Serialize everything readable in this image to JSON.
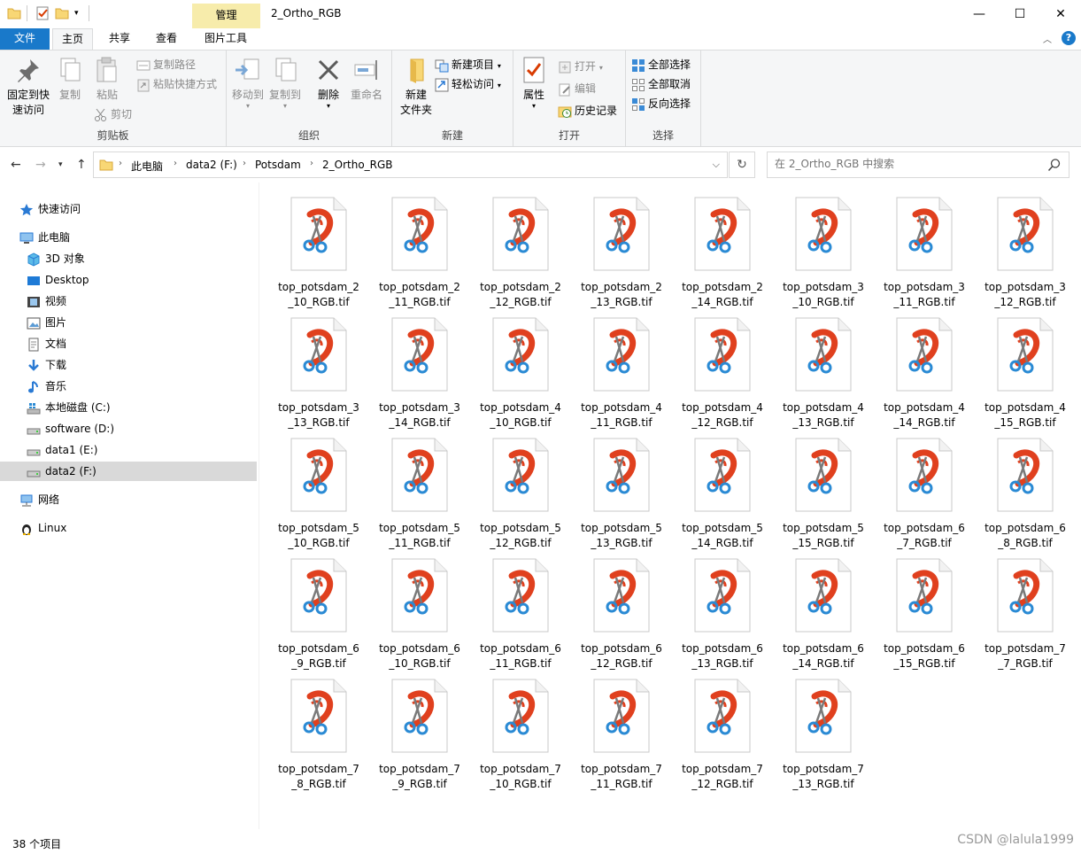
{
  "window": {
    "title": "2_Ortho_RGB",
    "manage_tab": "管理",
    "minimize": "—",
    "maximize": "☐",
    "close": "✕"
  },
  "ribbon_tabs": {
    "file": "文件",
    "home": "主页",
    "share": "共享",
    "view": "查看",
    "picture_tools": "图片工具"
  },
  "ribbon": {
    "clipboard": {
      "label": "剪贴板",
      "pin": "固定到快速访问",
      "pin_line1": "固定到快",
      "pin_line2": "速访问",
      "copy": "复制",
      "paste": "粘贴",
      "copy_path": "复制路径",
      "paste_shortcut": "粘贴快捷方式",
      "cut": "剪切"
    },
    "organize": {
      "label": "组织",
      "move_to": "移动到",
      "copy_to": "复制到",
      "delete": "删除",
      "rename": "重命名"
    },
    "new": {
      "label": "新建",
      "new_folder_line1": "新建",
      "new_folder_line2": "文件夹",
      "new_item": "新建项目",
      "easy_access": "轻松访问"
    },
    "open": {
      "label": "打开",
      "properties": "属性",
      "open": "打开",
      "edit": "编辑",
      "history": "历史记录"
    },
    "select": {
      "label": "选择",
      "select_all": "全部选择",
      "select_none": "全部取消",
      "invert": "反向选择"
    }
  },
  "address": {
    "crumbs": [
      "此电脑",
      "data2 (F:)",
      "Potsdam",
      "2_Ortho_RGB"
    ],
    "search_placeholder": "在 2_Ortho_RGB 中搜索"
  },
  "nav": {
    "quick_access": "快速访问",
    "this_pc": "此电脑",
    "objects3d": "3D 对象",
    "desktop": "Desktop",
    "videos": "视频",
    "pictures": "图片",
    "documents": "文档",
    "downloads": "下载",
    "music": "音乐",
    "drive_c": "本地磁盘 (C:)",
    "drive_d": "software (D:)",
    "drive_e": "data1 (E:)",
    "drive_f": "data2 (F:)",
    "network": "网络",
    "linux": "Linux"
  },
  "files": [
    {
      "line1": "top_potsdam_2",
      "line2": "_10_RGB.tif"
    },
    {
      "line1": "top_potsdam_2",
      "line2": "_11_RGB.tif"
    },
    {
      "line1": "top_potsdam_2",
      "line2": "_12_RGB.tif"
    },
    {
      "line1": "top_potsdam_2",
      "line2": "_13_RGB.tif"
    },
    {
      "line1": "top_potsdam_2",
      "line2": "_14_RGB.tif"
    },
    {
      "line1": "top_potsdam_3",
      "line2": "_10_RGB.tif"
    },
    {
      "line1": "top_potsdam_3",
      "line2": "_11_RGB.tif"
    },
    {
      "line1": "top_potsdam_3",
      "line2": "_12_RGB.tif"
    },
    {
      "line1": "top_potsdam_3",
      "line2": "_13_RGB.tif"
    },
    {
      "line1": "top_potsdam_3",
      "line2": "_14_RGB.tif"
    },
    {
      "line1": "top_potsdam_4",
      "line2": "_10_RGB.tif"
    },
    {
      "line1": "top_potsdam_4",
      "line2": "_11_RGB.tif"
    },
    {
      "line1": "top_potsdam_4",
      "line2": "_12_RGB.tif"
    },
    {
      "line1": "top_potsdam_4",
      "line2": "_13_RGB.tif"
    },
    {
      "line1": "top_potsdam_4",
      "line2": "_14_RGB.tif"
    },
    {
      "line1": "top_potsdam_4",
      "line2": "_15_RGB.tif"
    },
    {
      "line1": "top_potsdam_5",
      "line2": "_10_RGB.tif"
    },
    {
      "line1": "top_potsdam_5",
      "line2": "_11_RGB.tif"
    },
    {
      "line1": "top_potsdam_5",
      "line2": "_12_RGB.tif"
    },
    {
      "line1": "top_potsdam_5",
      "line2": "_13_RGB.tif"
    },
    {
      "line1": "top_potsdam_5",
      "line2": "_14_RGB.tif"
    },
    {
      "line1": "top_potsdam_5",
      "line2": "_15_RGB.tif"
    },
    {
      "line1": "top_potsdam_6",
      "line2": "_7_RGB.tif"
    },
    {
      "line1": "top_potsdam_6",
      "line2": "_8_RGB.tif"
    },
    {
      "line1": "top_potsdam_6",
      "line2": "_9_RGB.tif"
    },
    {
      "line1": "top_potsdam_6",
      "line2": "_10_RGB.tif"
    },
    {
      "line1": "top_potsdam_6",
      "line2": "_11_RGB.tif"
    },
    {
      "line1": "top_potsdam_6",
      "line2": "_12_RGB.tif"
    },
    {
      "line1": "top_potsdam_6",
      "line2": "_13_RGB.tif"
    },
    {
      "line1": "top_potsdam_6",
      "line2": "_14_RGB.tif"
    },
    {
      "line1": "top_potsdam_6",
      "line2": "_15_RGB.tif"
    },
    {
      "line1": "top_potsdam_7",
      "line2": "_7_RGB.tif"
    },
    {
      "line1": "top_potsdam_7",
      "line2": "_8_RGB.tif"
    },
    {
      "line1": "top_potsdam_7",
      "line2": "_9_RGB.tif"
    },
    {
      "line1": "top_potsdam_7",
      "line2": "_10_RGB.tif"
    },
    {
      "line1": "top_potsdam_7",
      "line2": "_11_RGB.tif"
    },
    {
      "line1": "top_potsdam_7",
      "line2": "_12_RGB.tif"
    },
    {
      "line1": "top_potsdam_7",
      "line2": "_13_RGB.tif"
    }
  ],
  "status": {
    "count": "38 个项目",
    "watermark": "CSDN @lalula1999"
  },
  "colors": {
    "accent": "#1979ca",
    "manage_tab_bg": "#f7ecab",
    "selected_nav": "#d9d9d9",
    "ribbon_bg": "#f5f6f7",
    "snip_red": "#e0401e",
    "snip_blue": "#2a8ad4"
  }
}
